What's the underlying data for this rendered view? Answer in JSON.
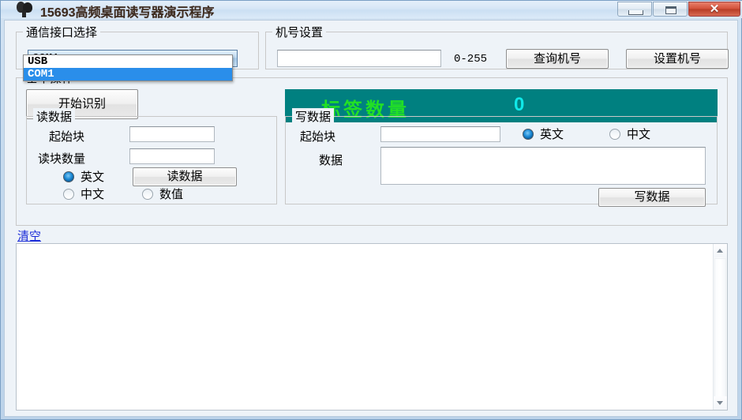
{
  "window": {
    "title": "15693高频桌面读写器演示程序",
    "icon": "app-logo-icon",
    "minimize_label": "–",
    "maximize_label": "❑",
    "close_label": "✕"
  },
  "comm_group": {
    "legend": "通信接口选择",
    "combo_value": "COM1",
    "options": [
      {
        "label": "USB",
        "selected": false
      },
      {
        "label": "COM1",
        "selected": true
      }
    ]
  },
  "machine_group": {
    "legend": "机号设置",
    "input_value": "",
    "range_hint": "0-255",
    "query_button": "查询机号",
    "set_button": "设置机号"
  },
  "operation_group": {
    "legend": "基本操作",
    "start_button": "开始识别",
    "banner": {
      "label": "标签数量",
      "count": "0",
      "bg_color": "#008080",
      "label_color": "#22e025",
      "count_color": "#10e8e8"
    }
  },
  "read_group": {
    "legend": "读数据",
    "start_block_label": "起始块",
    "start_block_value": "",
    "block_count_label": "读块数量",
    "block_count_value": "",
    "radio_english": "英文",
    "radio_chinese": "中文",
    "radio_numeric": "数值",
    "selected_radio": "英文",
    "read_button": "读数据"
  },
  "write_group": {
    "legend": "写数据",
    "start_block_label": "起始块",
    "start_block_value": "",
    "data_label": "数据",
    "data_value": "",
    "radio_english": "英文",
    "radio_chinese": "中文",
    "selected_radio": "英文",
    "write_button": "写数据"
  },
  "log": {
    "clear_link": "清空",
    "content": ""
  }
}
